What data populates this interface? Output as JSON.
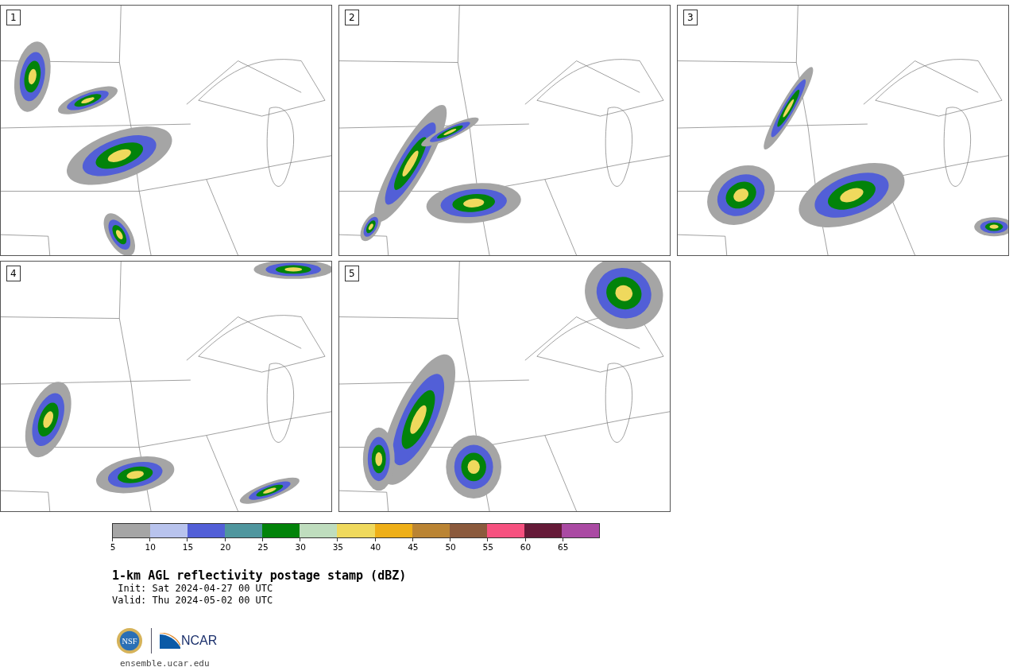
{
  "panels": [
    {
      "number": "1"
    },
    {
      "number": "2"
    },
    {
      "number": "3"
    },
    {
      "number": "4"
    },
    {
      "number": "5"
    }
  ],
  "colorbar": {
    "bins": [
      {
        "color": "#a5a5a5"
      },
      {
        "color": "#b8c3ed"
      },
      {
        "color": "#525fd7"
      },
      {
        "color": "#4f969e"
      },
      {
        "color": "#02830a"
      },
      {
        "color": "#bfddbe"
      },
      {
        "color": "#efd95d"
      },
      {
        "color": "#eeaf18"
      },
      {
        "color": "#ba8433"
      },
      {
        "color": "#8b5a3d"
      },
      {
        "color": "#f6517f"
      },
      {
        "color": "#651a38"
      },
      {
        "color": "#aa4aa3"
      }
    ],
    "ticks": [
      "5",
      "10",
      "15",
      "20",
      "25",
      "30",
      "35",
      "40",
      "45",
      "50",
      "55",
      "60",
      "65"
    ]
  },
  "title": "1-km AGL reflectivity postage stamp (dBZ)",
  "init": " Init: Sat 2024-04-27 00 UTC",
  "valid": "Valid: Thu 2024-05-02 00 UTC",
  "logos": {
    "nsf": "NSF",
    "ncar": "NCAR"
  },
  "footer": "ensemble.ucar.edu"
}
